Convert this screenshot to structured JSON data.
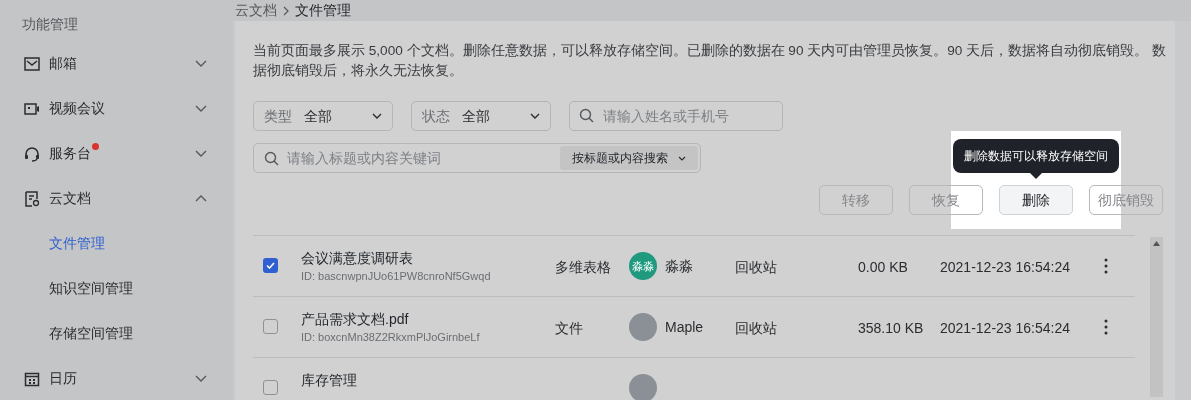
{
  "sidebar": {
    "title": "功能管理",
    "items": [
      {
        "kind": "mail",
        "label": "邮箱",
        "expanded": false,
        "badge": false
      },
      {
        "kind": "video",
        "label": "视频会议",
        "expanded": false,
        "badge": false
      },
      {
        "kind": "headset",
        "label": "服务台",
        "expanded": false,
        "badge": true
      },
      {
        "kind": "doc",
        "label": "云文档",
        "expanded": true,
        "badge": false,
        "children": [
          {
            "label": "文件管理",
            "selected": true
          },
          {
            "label": "知识空间管理",
            "selected": false
          },
          {
            "label": "存储空间管理",
            "selected": false
          }
        ]
      },
      {
        "kind": "calendar",
        "label": "日历",
        "expanded": false,
        "badge": false
      }
    ]
  },
  "breadcrumb": [
    "云文档",
    "文件管理"
  ],
  "notice": "当前页面最多展示 5,000 个文档。删除任意数据，可以释放存储空间。已删除的数据在 90 天内可由管理员恢复。90 天后，数据将自动彻底销毁。 数据彻底销毁后，将永久无法恢复。",
  "filters": {
    "type": {
      "label": "类型",
      "value": "全部"
    },
    "status": {
      "label": "状态",
      "value": "全部"
    },
    "person_search": {
      "placeholder": "请输入姓名或手机号"
    },
    "keyword_search": {
      "placeholder": "请输入标题或内容关键词",
      "mode": "按标题或内容搜索"
    }
  },
  "actions": [
    {
      "label": "转移",
      "disabled": true,
      "spotlight": false
    },
    {
      "label": "恢复",
      "disabled": true,
      "spotlight": false
    },
    {
      "label": "删除",
      "disabled": false,
      "spotlight": true
    },
    {
      "label": "彻底销毁",
      "disabled": true,
      "spotlight": false
    }
  ],
  "tooltip": "删除数据可以释放存储空间",
  "table": {
    "rows": [
      {
        "checked": true,
        "name": "会议满意度调研表",
        "id": "ID: bascnwpnJUo61PW8cnroNf5Gwqd",
        "type": "多维表格",
        "owner": {
          "kind": "initials",
          "avatar_text": "淼淼",
          "color": "#1f9a7e",
          "name": "淼淼"
        },
        "location": "回收站",
        "size": "0.00 KB",
        "time": "2021-12-23 16:54:24"
      },
      {
        "checked": false,
        "name": "产品需求文档.pdf",
        "id": "ID: boxcnMn38Z2RkxmPlJoGirnbeLf",
        "type": "文件",
        "owner": {
          "kind": "photo",
          "name": "Maple"
        },
        "location": "回收站",
        "size": "358.10 KB",
        "time": "2021-12-23 16:54:24"
      },
      {
        "checked": false,
        "name": "库存管理",
        "owner": {
          "kind": "photo"
        }
      }
    ]
  }
}
